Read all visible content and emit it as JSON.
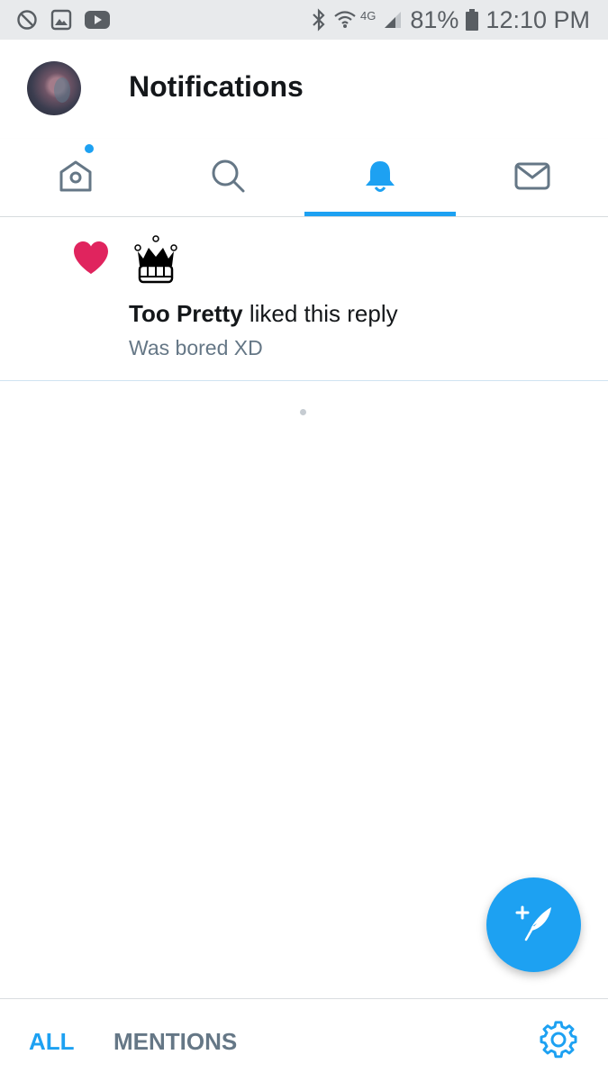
{
  "status_bar": {
    "network": "4G",
    "battery": "81%",
    "time": "12:10 PM",
    "icons": [
      "do-not-disturb-icon",
      "gallery-icon",
      "youtube-icon",
      "bluetooth-icon",
      "wifi-icon",
      "signal-icon",
      "battery-icon"
    ]
  },
  "header": {
    "title": "Notifications"
  },
  "tabs": [
    {
      "name": "home",
      "icon": "home-icon",
      "has_badge": true,
      "active": false
    },
    {
      "name": "search",
      "icon": "search-icon",
      "active": false
    },
    {
      "name": "notifications",
      "icon": "bell-icon",
      "active": true
    },
    {
      "name": "messages",
      "icon": "mail-icon",
      "active": false
    }
  ],
  "notifications": [
    {
      "icon": "heart-icon",
      "user_name": "Too Pretty",
      "action": " liked this reply",
      "snippet": "Was bored XD"
    }
  ],
  "bottom_bar": {
    "all_label": "ALL",
    "mentions_label": "MENTIONS"
  },
  "colors": {
    "accent": "#1da1f2",
    "like": "#e0245e",
    "muted": "#657786"
  }
}
